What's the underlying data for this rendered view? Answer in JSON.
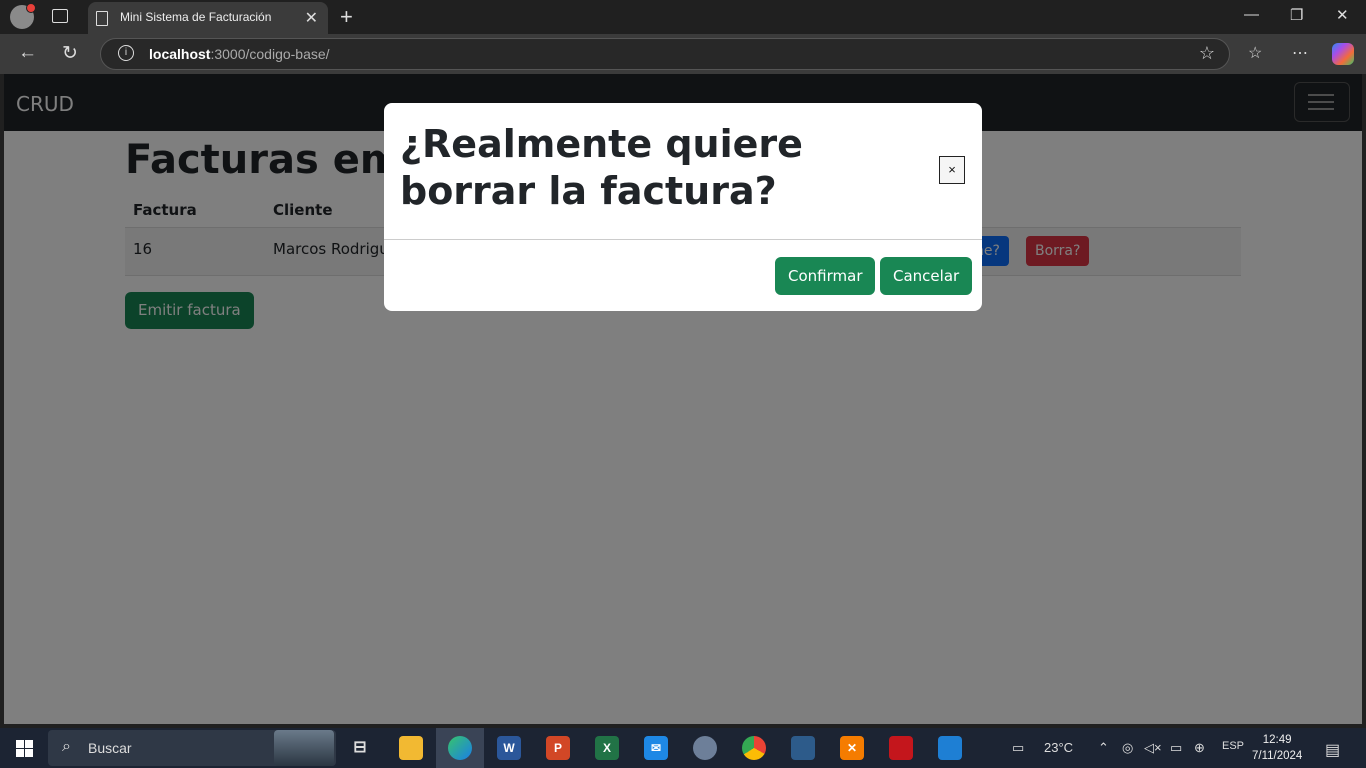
{
  "browser": {
    "tab_title": "Mini Sistema de Facturación",
    "url_host": "localhost",
    "url_path": ":3000/codigo-base/"
  },
  "app": {
    "brand": "CRUD",
    "page_title": "Facturas emitidas",
    "table": {
      "headers": [
        "Factura",
        "Cliente"
      ],
      "rows": [
        {
          "factura": "16",
          "cliente": "Marcos Rodriguez",
          "imprime_label": "Imprime?",
          "borra_label": "Borra?"
        }
      ]
    },
    "emit_label": "Emitir factura"
  },
  "modal": {
    "title": "¿Realmente quiere borrar la factura?",
    "close_label": "×",
    "confirm_label": "Confirmar",
    "cancel_label": "Cancelar"
  },
  "taskbar": {
    "search_label": "Buscar",
    "weather": "23°C",
    "language": "ESP",
    "time": "12:49",
    "date": "7/11/2024"
  },
  "colors": {
    "success": "#198754",
    "primary": "#0d6efd",
    "danger": "#dc3545",
    "navbar": "#212529"
  }
}
